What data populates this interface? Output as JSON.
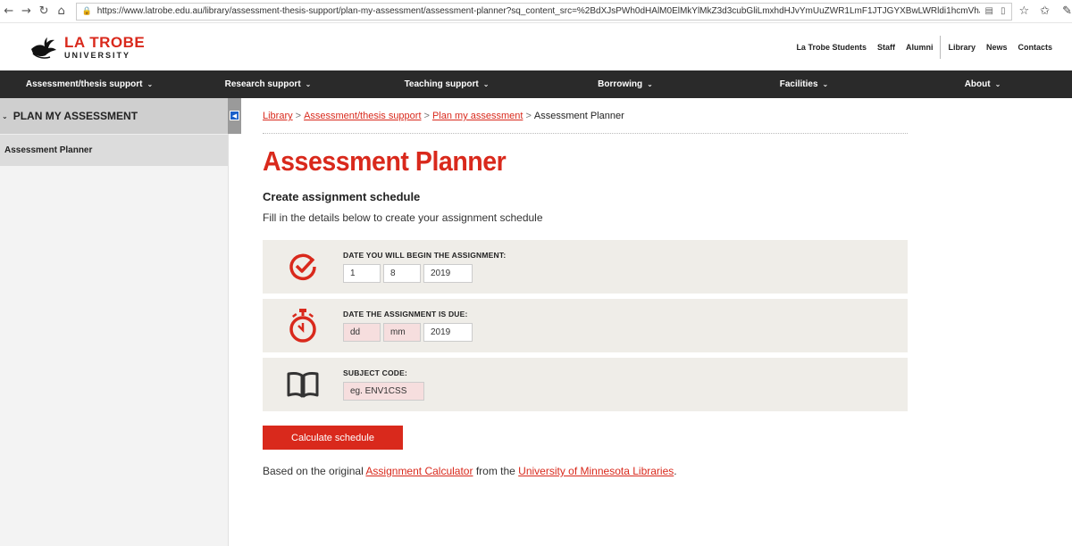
{
  "browser": {
    "url": "https://www.latrobe.edu.au/library/assessment-thesis-support/plan-my-assessment/assessment-planner?sq_content_src=%2BdXJsPWh0dHAlM0ElMkYlMkZ3d3cubGliLmxhdHJvYmUuZWR1LmF1JTJGYXBwLWRldi1hcmVhJTJGY2FsY3VsYXRvci11cGRhdGU"
  },
  "header": {
    "logo_main": "LA TROBE",
    "logo_sub": "UNIVERSITY",
    "top_links": [
      "La Trobe Students",
      "Staff",
      "Alumni",
      "Library",
      "News",
      "Contacts"
    ]
  },
  "nav": {
    "items": [
      "Assessment/thesis support",
      "Research support",
      "Teaching support",
      "Borrowing",
      "Facilities",
      "About"
    ]
  },
  "sidebar": {
    "heading": "PLAN MY ASSESSMENT",
    "item": "Assessment Planner"
  },
  "breadcrumb": {
    "items": [
      "Library",
      "Assessment/thesis support",
      "Plan my assessment"
    ],
    "current": "Assessment Planner"
  },
  "page": {
    "title": "Assessment Planner",
    "subtitle": "Create assignment schedule",
    "description": "Fill in the details below to create your assignment schedule"
  },
  "form": {
    "begin": {
      "label": "DATE YOU WILL BEGIN THE ASSIGNMENT:",
      "day": "1",
      "month": "8",
      "year": "2019"
    },
    "due": {
      "label": "DATE THE ASSIGNMENT IS DUE:",
      "day_placeholder": "dd",
      "month_placeholder": "mm",
      "year": "2019"
    },
    "subject": {
      "label": "SUBJECT CODE:",
      "placeholder": "eg. ENV1CSS"
    },
    "button": "Calculate schedule"
  },
  "footer": {
    "text1": "Based on the original ",
    "link1": "Assignment Calculator",
    "text2": " from the ",
    "link2": "University of Minnesota Libraries",
    "text3": "."
  },
  "colors": {
    "accent": "#d9291c",
    "nav_bg": "#2a2a2a",
    "row_bg": "#efede8"
  }
}
